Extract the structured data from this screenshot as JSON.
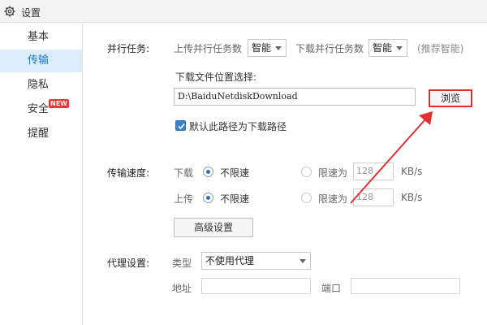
{
  "window": {
    "title": "设置",
    "icon": "gear-icon"
  },
  "sidebar": {
    "items": [
      {
        "label": "基本"
      },
      {
        "label": "传输",
        "active": true
      },
      {
        "label": "隐私"
      },
      {
        "label": "安全",
        "badge": "NEW"
      },
      {
        "label": "提醒"
      }
    ]
  },
  "parallel": {
    "section_label": "并行任务:",
    "upload_label": "上传并行任务数",
    "upload_value": "智能",
    "download_label": "下载并行任务数",
    "download_value": "智能",
    "hint": "(推荐智能)"
  },
  "download_location": {
    "label": "下载文件位置选择:",
    "path": "D:\\BaiduNetdiskDownload",
    "browse_label": "浏览",
    "default_checkbox_label": "默认此路径为下载路径",
    "default_checked": true
  },
  "speed": {
    "section_label": "传输速度:",
    "download_label": "下载",
    "upload_label": "上传",
    "unlimited_label": "不限速",
    "limit_label": "限速为",
    "download_limit_value": "128",
    "upload_limit_value": "128",
    "unit": "KB/s",
    "advanced_button": "高级设置"
  },
  "proxy": {
    "section_label": "代理设置:",
    "type_label": "类型",
    "type_value": "不使用代理",
    "address_label": "地址",
    "port_label": "端口"
  },
  "colors": {
    "accent": "#1f74c2",
    "active_bg": "#dbecfa",
    "badge": "#e53935",
    "highlight": "#e03030"
  }
}
